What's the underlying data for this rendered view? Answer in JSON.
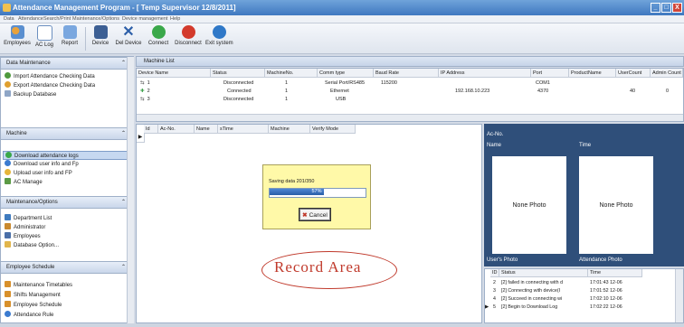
{
  "window": {
    "title": "Attendance Management Program - [ Temp Supervisor 12/8/2011]",
    "minimize": "_",
    "maximize": "□",
    "close": "X"
  },
  "menu": [
    "Data",
    "Attendance",
    "Search/Print",
    "Maintenance/Options",
    "Device management",
    "Help"
  ],
  "toolbar": {
    "employees": "Employees",
    "aclog": "AC Log",
    "report": "Report",
    "device": "Device",
    "deldevice": "Del Device",
    "connect": "Connect",
    "disconnect": "Disconnect",
    "exit": "Exit system"
  },
  "sidebar": {
    "data_maintenance": {
      "title": "Data Maintenance",
      "items": [
        "Import Attendance Checking Data",
        "Export Attendance Checking Data",
        "Backup Database"
      ]
    },
    "machine": {
      "title": "Machine",
      "items": [
        "Download attendance logs",
        "Download user info and Fp",
        "Upload user info and FP",
        "AC Manage"
      ]
    },
    "maintenance": {
      "title": "Maintenance/Options",
      "items": [
        "Department List",
        "Administrator",
        "Employees",
        "Database Option..."
      ]
    },
    "schedule": {
      "title": "Employee Schedule",
      "items": [
        "Maintenance Timetables",
        "Shifts Management",
        "Employee Schedule",
        "Attendance Rule"
      ]
    }
  },
  "machine_list": {
    "title": "Machine List",
    "columns": [
      "Device Name",
      "Status",
      "MachineNo.",
      "Comm type",
      "Baud Rate",
      "IP Address",
      "Port",
      "ProductName",
      "UserCount",
      "Admin Count"
    ],
    "rows": [
      {
        "name": "1",
        "status": "Disconnected",
        "no": "1",
        "comm": "Serial Port/RS485",
        "baud": "115200",
        "ip": "",
        "port": "COM1",
        "product": "",
        "users": "",
        "admins": ""
      },
      {
        "name": "2",
        "status": "Connected",
        "no": "1",
        "comm": "Ethernet",
        "baud": "",
        "ip": "192.168.10.223",
        "port": "4370",
        "product": "",
        "users": "40",
        "admins": "0"
      },
      {
        "name": "3",
        "status": "Disconnected",
        "no": "1",
        "comm": "USB",
        "baud": "",
        "ip": "",
        "port": "",
        "product": "",
        "users": "",
        "admins": ""
      }
    ]
  },
  "record_grid": {
    "columns": [
      "Id",
      "Ac-No.",
      "Name",
      "sTime",
      "Machine",
      "Verify Mode"
    ],
    "label": "Record Area"
  },
  "progress_dialog": {
    "message": "Saving data   201/350",
    "percent": 57,
    "percent_label": "57%",
    "cancel": "Cancel"
  },
  "photo_panel": {
    "acno": "Ac-No.",
    "name": "Name",
    "time": "Time",
    "none_photo_1": "None Photo",
    "none_photo_2": "None Photo",
    "users_photo": "User's Photo",
    "attendance_photo": "Attendance Photo"
  },
  "log": {
    "columns": [
      "ID",
      "Status",
      "Time"
    ],
    "rows": [
      {
        "id": "2",
        "status": "[2] failed in connecting with d",
        "time": "17:01:43 12-06"
      },
      {
        "id": "3",
        "status": "[2] Connecting with device(I",
        "time": "17:01:52 12-06"
      },
      {
        "id": "4",
        "status": "[2] Succeed in connecting wi",
        "time": "17:02:10 12-06"
      },
      {
        "id": "5",
        "status": "[2] Begin to Download Log",
        "time": "17:02:22 12-06"
      }
    ]
  },
  "colors": {
    "title_bar": "#3f78c0",
    "dialog_bg": "#fff9a8",
    "record_label": "#c0392b",
    "photo_panel": "#2f4f7a"
  }
}
